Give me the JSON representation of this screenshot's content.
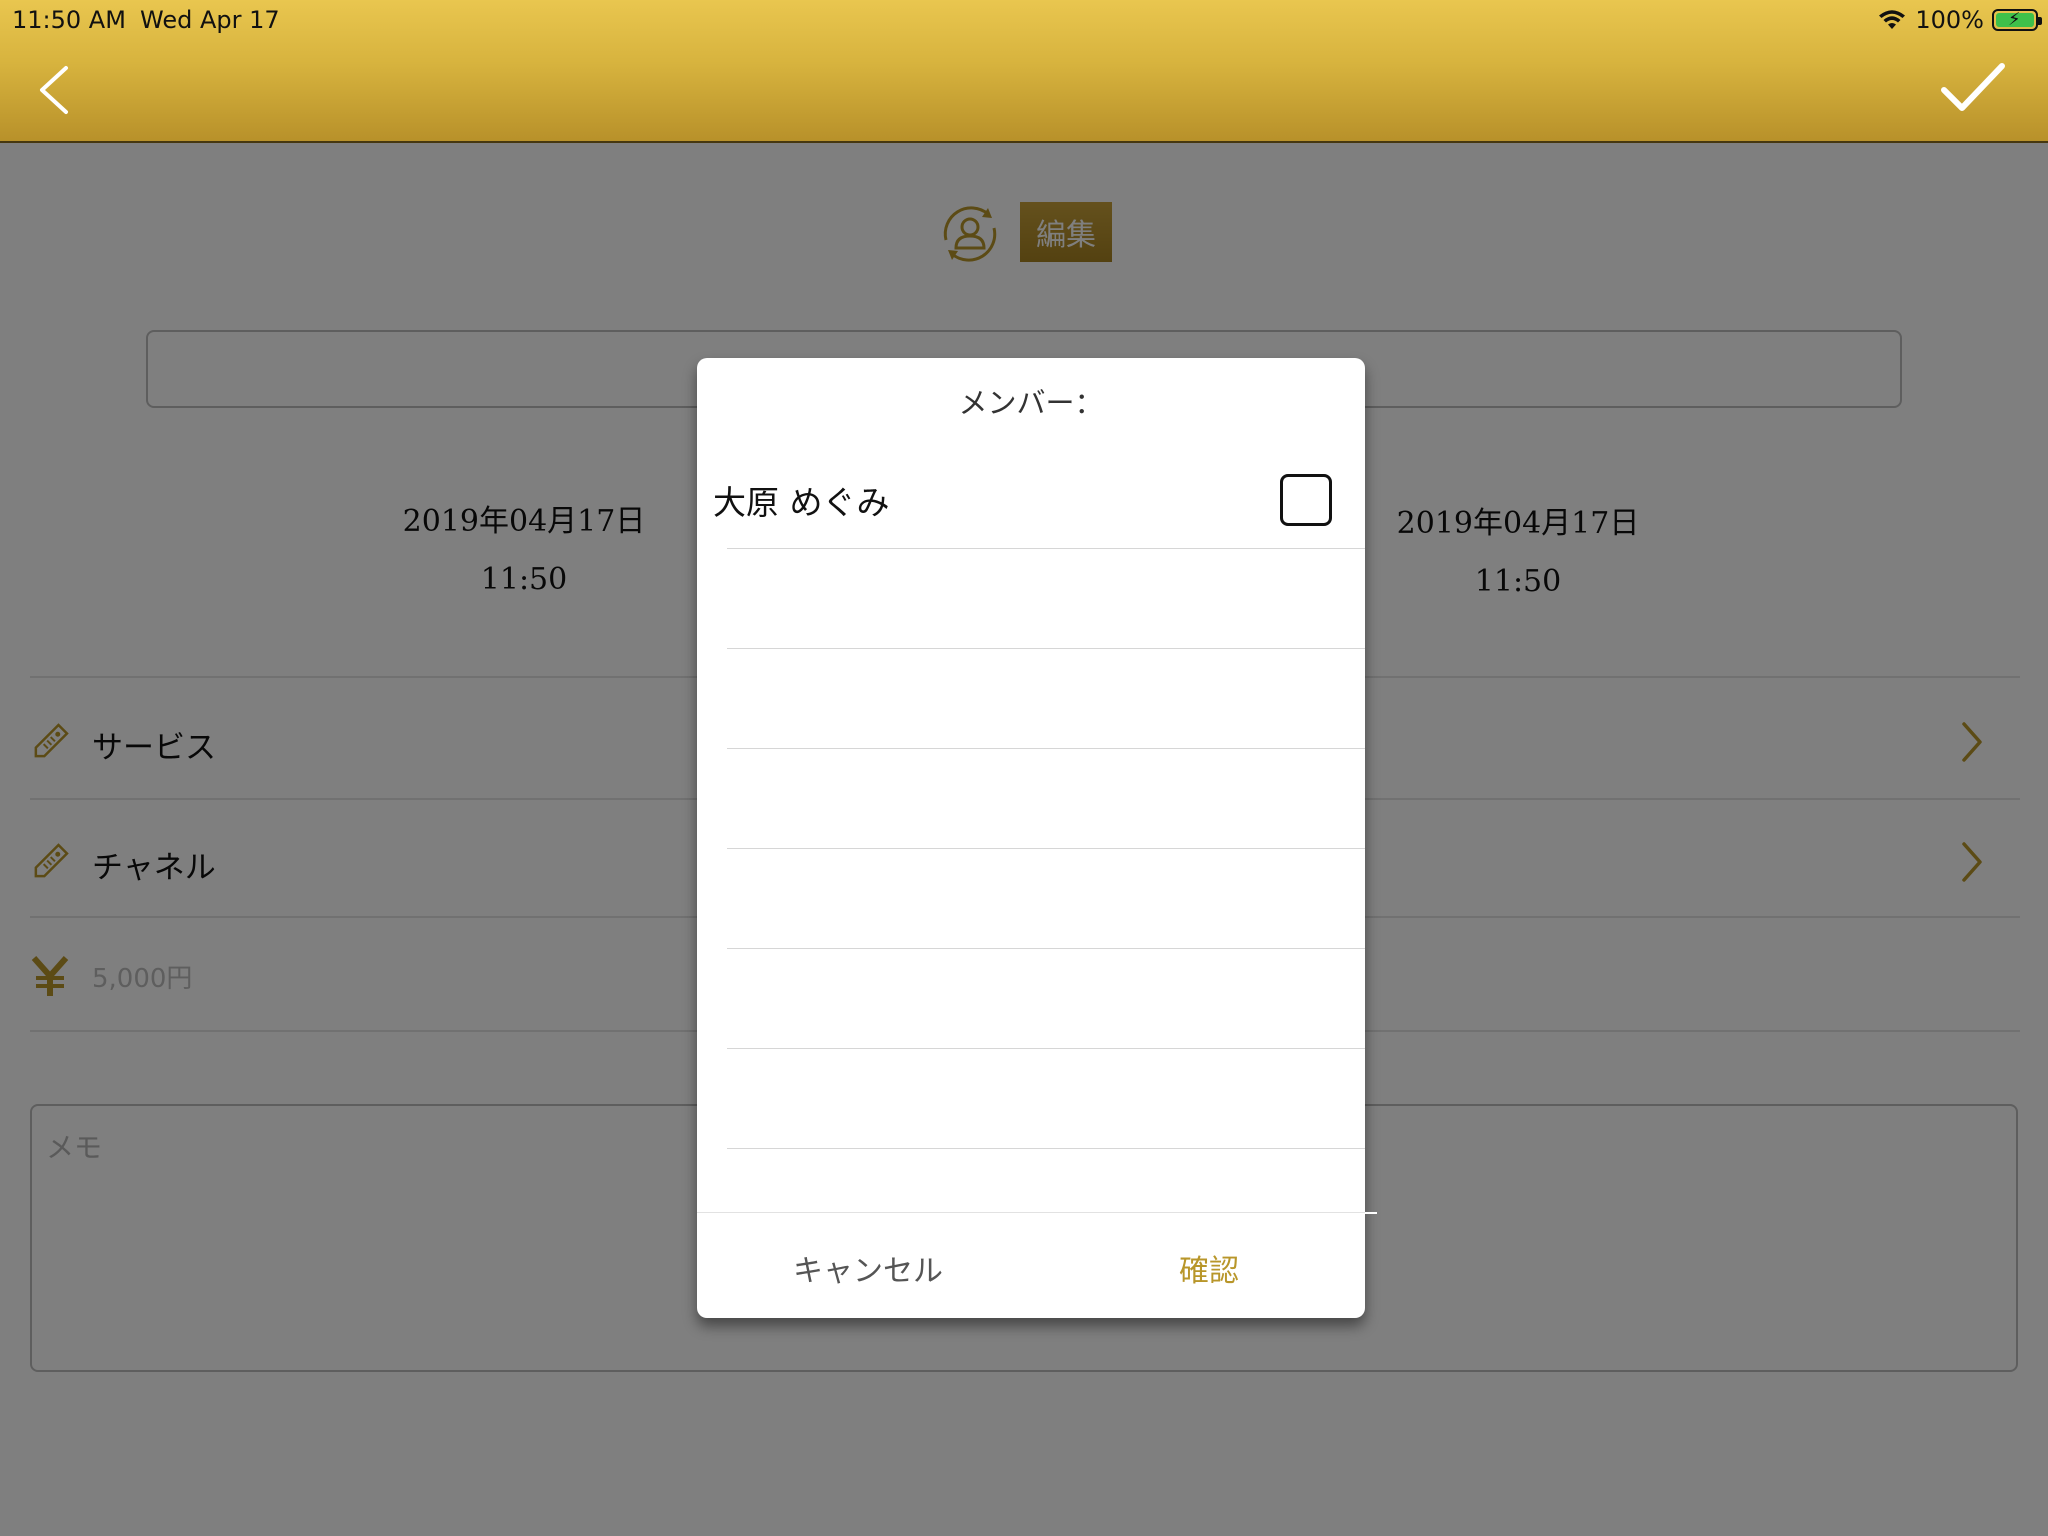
{
  "status_bar": {
    "time": "11:50 AM",
    "date": "Wed Apr 17",
    "battery": "100%"
  },
  "nav": {
    "back_icon": "chevron-left-icon",
    "confirm_icon": "checkmark-icon"
  },
  "form": {
    "edit_label": "編集",
    "start": {
      "date": "2019年04月17日",
      "time": "11:50"
    },
    "end": {
      "date": "2019年04月17日",
      "time": "11:50"
    },
    "service_label": "サービス",
    "channel_label": "チャネル",
    "price": "5,000円",
    "memo_placeholder": "メモ"
  },
  "modal": {
    "title": "メンバー：",
    "members": [
      {
        "name": "大原 めぐみ",
        "checked": false
      }
    ],
    "cancel_label": "キャンセル",
    "confirm_label": "確認"
  },
  "colors": {
    "accent_gold": "#b8962a",
    "navbar_top": "#e9c64f",
    "navbar_bottom": "#b8912a"
  }
}
